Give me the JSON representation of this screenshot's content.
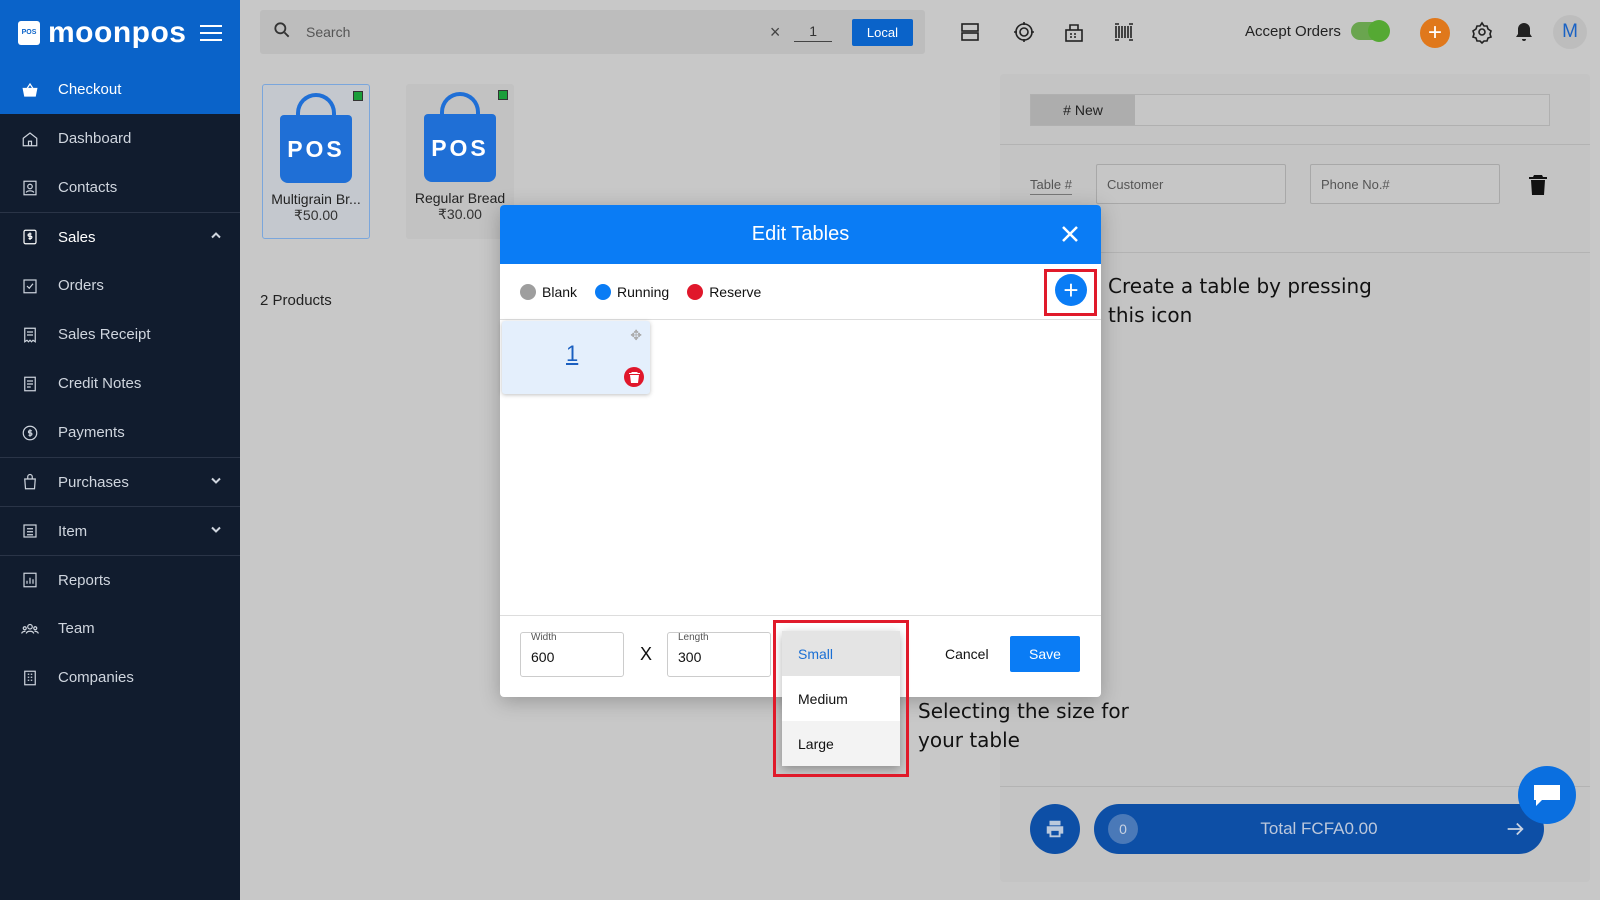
{
  "app": {
    "brand": "moonpos",
    "brand_logo_text": "POS"
  },
  "sidebar": {
    "items": [
      {
        "label": "Checkout",
        "icon": "basket-icon"
      },
      {
        "label": "Dashboard",
        "icon": "home-icon"
      },
      {
        "label": "Contacts",
        "icon": "contacts-icon"
      },
      {
        "label": "Sales",
        "icon": "dollar-doc-icon"
      },
      {
        "label": "Orders",
        "icon": "checklist-icon"
      },
      {
        "label": "Sales Receipt",
        "icon": "receipt-icon"
      },
      {
        "label": "Credit Notes",
        "icon": "note-icon"
      },
      {
        "label": "Payments",
        "icon": "coin-icon"
      },
      {
        "label": "Purchases",
        "icon": "bag-icon"
      },
      {
        "label": "Item",
        "icon": "list-icon"
      },
      {
        "label": "Reports",
        "icon": "chart-icon"
      },
      {
        "label": "Team",
        "icon": "team-icon"
      },
      {
        "label": "Companies",
        "icon": "building-icon"
      }
    ]
  },
  "topbar": {
    "search_placeholder": "Search",
    "clear": "×",
    "quantity": "1",
    "local_label": "Local",
    "accept_orders_label": "Accept Orders",
    "avatar_initial": "M",
    "plus": "+"
  },
  "products": {
    "items": [
      {
        "name": "Multigrain Br...",
        "price": "₹50.00",
        "logo": "POS"
      },
      {
        "name": "Regular Bread",
        "price": "₹30.00",
        "logo": "POS"
      }
    ],
    "count_label": "2 Products"
  },
  "cart": {
    "tab_label": "# New",
    "table_label": "Table #",
    "customer_placeholder": "Customer",
    "phone_placeholder": "Phone No.#",
    "item_count": "0",
    "total_label": "Total FCFA0.00"
  },
  "modal": {
    "title": "Edit Tables",
    "legend": [
      {
        "label": "Blank",
        "color": "#9e9e9e"
      },
      {
        "label": "Running",
        "color": "#0a7cf5"
      },
      {
        "label": "Reserve",
        "color": "#e0172b"
      }
    ],
    "add_symbol": "+",
    "table_number": "1",
    "width_label": "Width",
    "width_value": "600",
    "length_label": "Length",
    "length_value": "300",
    "x_separator": "X",
    "size_options": [
      "Small",
      "Medium",
      "Large"
    ],
    "cancel_label": "Cancel",
    "save_label": "Save"
  },
  "annotations": {
    "create_line1": "Create a table by pressing",
    "create_line2": "this icon",
    "size_line1": "Selecting the size for",
    "size_line2": "your table"
  },
  "colors": {
    "primary": "#0a63c9",
    "modal_header": "#0a7cf5",
    "highlight": "#e01a2a",
    "sidebar_bg": "#111c2e"
  }
}
